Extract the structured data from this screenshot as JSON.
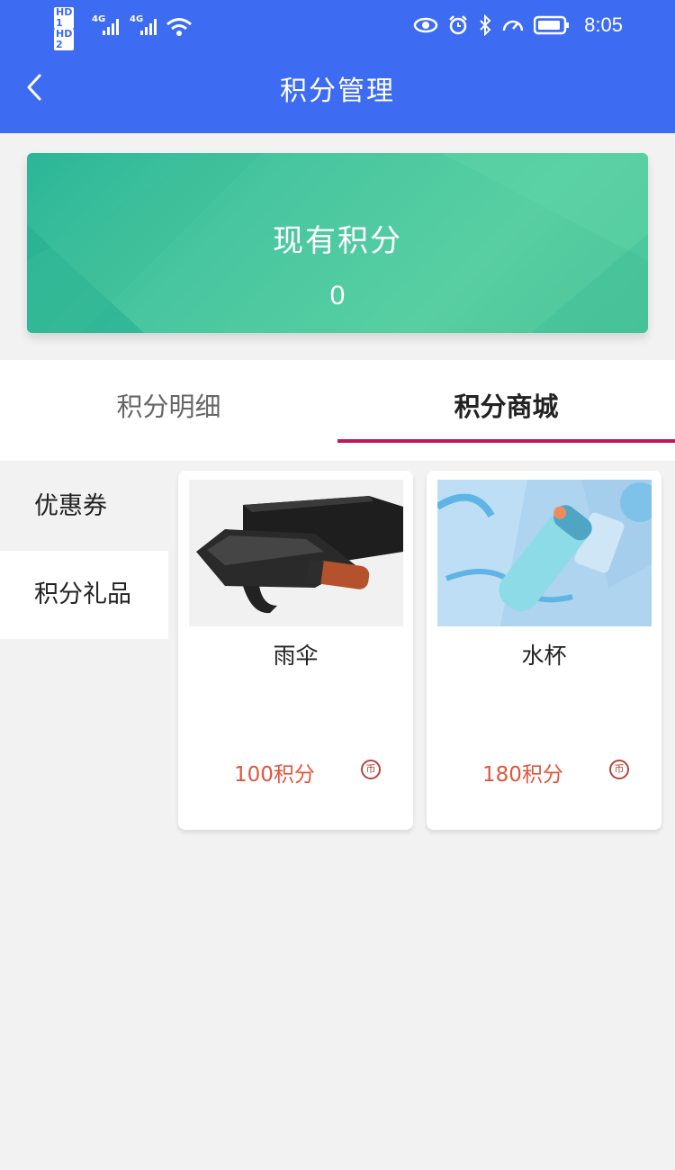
{
  "status_bar": {
    "sim1": "HD 1",
    "sim2": "HD 2",
    "net1": "4G",
    "net2": "4G",
    "time": "8:05"
  },
  "nav": {
    "title": "积分管理"
  },
  "points_card": {
    "label": "现有积分",
    "value": "0"
  },
  "tabs": [
    {
      "label": "积分明细",
      "active": false
    },
    {
      "label": "积分商城",
      "active": true
    }
  ],
  "side_menu": [
    {
      "label": "优惠券",
      "active": false
    },
    {
      "label": "积分礼品",
      "active": true
    }
  ],
  "products": [
    {
      "name": "雨伞",
      "price": "100积分",
      "image": "umbrella"
    },
    {
      "name": "水杯",
      "price": "180积分",
      "image": "water-bottle"
    }
  ],
  "colors": {
    "header": "#3d6cf2",
    "card_green": "#4cc49a",
    "tab_accent": "#c2185b",
    "price": "#e0563c"
  }
}
